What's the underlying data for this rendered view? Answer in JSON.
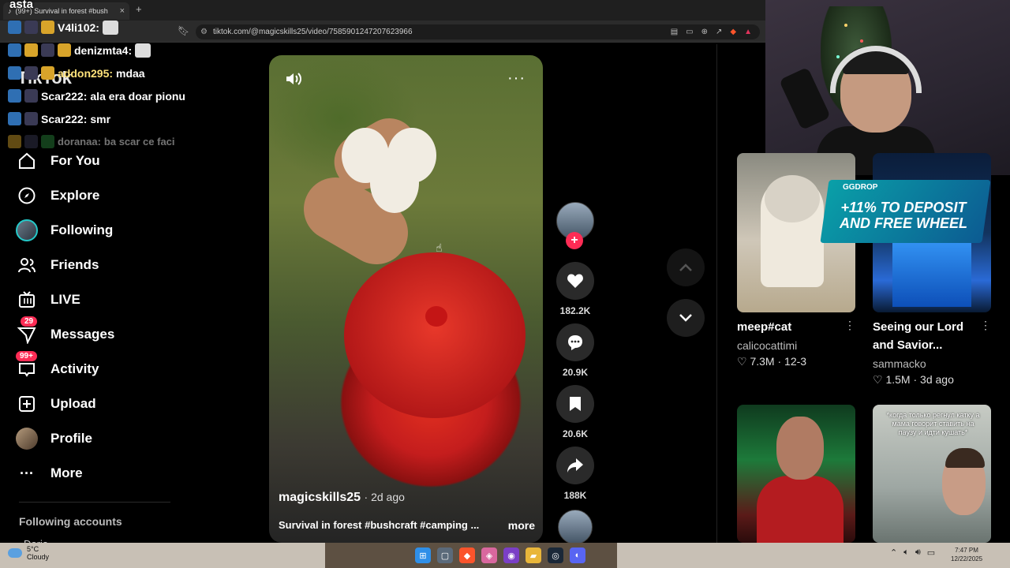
{
  "overlay": {
    "streamer_name": "asta",
    "tiktok_logo": "TikTok",
    "chat": [
      {
        "user": "V4li102:",
        "message": "",
        "style": "normal"
      },
      {
        "user": "denizmta4:",
        "message": "",
        "style": "normal"
      },
      {
        "user": "addon295:",
        "message": "mdaa",
        "style": "yellow"
      },
      {
        "user": "Scar222:",
        "message": "ala era doar pionu",
        "style": "normal"
      },
      {
        "user": "Scar222:",
        "message": "smr",
        "style": "normal"
      },
      {
        "user": "doranaa:",
        "message": "ba scar ce faci",
        "style": "faded"
      }
    ]
  },
  "browser": {
    "tab_title": "(99+) Survival in forest #bush",
    "url": "tiktok.com/@magicskills25/video/7585901247207623966"
  },
  "sidebar": {
    "items": [
      {
        "label": "For You",
        "icon": "home-icon"
      },
      {
        "label": "Explore",
        "icon": "compass-icon"
      },
      {
        "label": "Following",
        "icon": "following-avatar"
      },
      {
        "label": "Friends",
        "icon": "friends-icon"
      },
      {
        "label": "LIVE",
        "icon": "live-icon"
      },
      {
        "label": "Messages",
        "icon": "messages-icon",
        "badge": "29"
      },
      {
        "label": "Activity",
        "icon": "activity-icon",
        "badge": "99+"
      },
      {
        "label": "Upload",
        "icon": "upload-icon"
      },
      {
        "label": "Profile",
        "icon": "profile-avatar"
      },
      {
        "label": "More",
        "icon": "more-icon"
      }
    ],
    "following_accounts": "Following accounts",
    "first_account": "Doria"
  },
  "video": {
    "author": "magicskills25",
    "time_ago": "2d ago",
    "caption": "Survival in forest #bushcraft #camping ...",
    "more_label": "more"
  },
  "actions": {
    "likes": "182.2K",
    "comments": "20.9K",
    "saves": "20.6K",
    "shares": "188K"
  },
  "recommended": [
    {
      "title": "meep#cat",
      "author": "calicocattimi",
      "likes": "7.3M",
      "date": "12-3"
    },
    {
      "title_line1": "Seeing our Lord",
      "title_line2": "and Savior...",
      "author": "sammacko",
      "likes": "1.5M",
      "date": "3d ago"
    }
  ],
  "ad": {
    "logo": "GGDROP",
    "text": "+11% TO DEPOSIT AND FREE WHEEL"
  },
  "room_thumb_text": "*когда только регнул катку а мама говорит ставить на паузу и идти кушать*",
  "taskbar": {
    "temp": "5°C",
    "condition": "Cloudy",
    "time": "7:47 PM",
    "date": "12/22/2025"
  },
  "colors": {
    "accent": "#fe2c55",
    "teal": "#25c9c9"
  }
}
